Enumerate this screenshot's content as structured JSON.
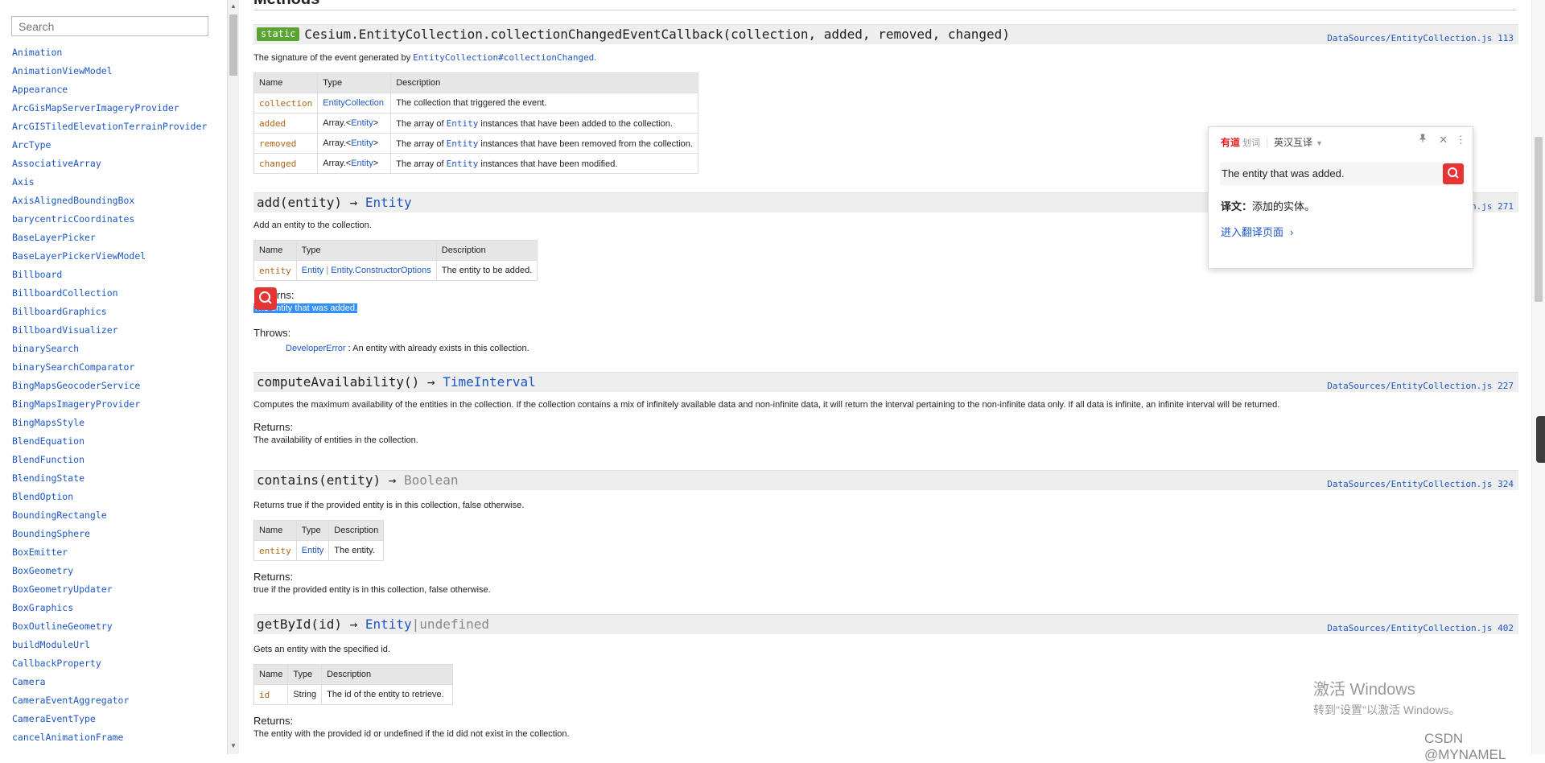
{
  "sidebar": {
    "search_placeholder": "Search",
    "items": [
      "Animation",
      "AnimationViewModel",
      "Appearance",
      "ArcGisMapServerImageryProvider",
      "ArcGISTiledElevationTerrainProvider",
      "ArcType",
      "AssociativeArray",
      "Axis",
      "AxisAlignedBoundingBox",
      "barycentricCoordinates",
      "BaseLayerPicker",
      "BaseLayerPickerViewModel",
      "Billboard",
      "BillboardCollection",
      "BillboardGraphics",
      "BillboardVisualizer",
      "binarySearch",
      "binarySearchComparator",
      "BingMapsGeocoderService",
      "BingMapsImageryProvider",
      "BingMapsStyle",
      "BlendEquation",
      "BlendFunction",
      "BlendingState",
      "BlendOption",
      "BoundingRectangle",
      "BoundingSphere",
      "BoxEmitter",
      "BoxGeometry",
      "BoxGeometryUpdater",
      "BoxGraphics",
      "BoxOutlineGeometry",
      "buildModuleUrl",
      "CallbackProperty",
      "Camera",
      "CameraEventAggregator",
      "CameraEventType",
      "cancelAnimationFrame"
    ]
  },
  "main": {
    "section_title": "Methods",
    "col_name": "Name",
    "col_type": "Type",
    "col_desc": "Description",
    "returns_label": "Returns:",
    "throws_label": "Throws:",
    "m1": {
      "badge": "static",
      "signature": "Cesium.EntityCollection.collectionChangedEventCallback(collection, added, removed, changed)",
      "source": "DataSources/EntityCollection.js 113",
      "desc_prefix": "The signature of the event generated by ",
      "desc_link": "EntityCollection#collectionChanged",
      "desc_suffix": ".",
      "rows": [
        {
          "name": "collection",
          "type": "EntityCollection",
          "pre": "The collection that triggered the event.",
          "link": "",
          "post": ""
        },
        {
          "name": "added",
          "type": "Entity",
          "pre": "The array of ",
          "link": "Entity",
          "post": " instances that have been added to the collection."
        },
        {
          "name": "removed",
          "type": "Entity",
          "pre": "The array of ",
          "link": "Entity",
          "post": " instances that have been removed from the collection."
        },
        {
          "name": "changed",
          "type": "Entity",
          "pre": "The array of ",
          "link": "Entity",
          "post": " instances that have been modified."
        }
      ],
      "array_prefix": "Array.<",
      "array_suffix": ">"
    },
    "m2": {
      "signature": "add(entity) → ",
      "return_type": "Entity",
      "source": "DataSources/EntityCollection.js 271",
      "desc": "Add an entity to the collection.",
      "param_name": "entity",
      "param_type1": "Entity",
      "param_sep": " | ",
      "param_type2": "Entity.ConstructorOptions",
      "param_desc": "The entity to be added.",
      "returns_label_visible": "turns:",
      "returns": "The entity that was added.",
      "throws_type": "DeveloperError",
      "throws_text": " : An entity with already exists in this collection."
    },
    "m3": {
      "signature": "computeAvailability() → ",
      "return_type": "TimeInterval",
      "source": "DataSources/EntityCollection.js 227",
      "desc": "Computes the maximum availability of the entities in the collection. If the collection contains a mix of infinitely available data and non-infinite data, it will return the interval pertaining to the non-infinite data only. If all data is infinite, an infinite interval will be returned.",
      "returns": "The availability of entities in the collection."
    },
    "m4": {
      "signature": "contains(entity) → ",
      "return_type": "Boolean",
      "source": "DataSources/EntityCollection.js 324",
      "desc": "Returns true if the provided entity is in this collection, false otherwise.",
      "param_name": "entity",
      "param_type": "Entity",
      "param_desc": "The entity.",
      "returns": "true if the provided entity is in this collection, false otherwise."
    },
    "m5": {
      "signature": "getById(id) → ",
      "return_type": "Entity",
      "return_sep": "|",
      "return_type2": "undefined",
      "source": "DataSources/EntityCollection.js 402",
      "desc": "Gets an entity with the specified id.",
      "param_name": "id",
      "param_type": "String",
      "param_desc": "The id of the entity to retrieve.",
      "returns": "The entity with the provided id or undefined if the id did not exist in the collection."
    }
  },
  "youdao": {
    "logo": "有道",
    "logo_sub": "划词",
    "mode": "英汉互译",
    "query": "The entity that was added.",
    "trans_label": "译文：",
    "trans_text": "添加的实体。",
    "link_text": "进入翻译页面"
  },
  "watermark": {
    "win_line1": "激活 Windows",
    "win_line2": "转到\"设置\"以激活 Windows。",
    "csdn": "CSDN @MYNAMEL"
  },
  "colors": {
    "link": "#1c57c4",
    "param_name": "#b06515",
    "static_badge": "#5aa531",
    "youdao_red": "#e63333",
    "highlight": "#3390ff"
  }
}
